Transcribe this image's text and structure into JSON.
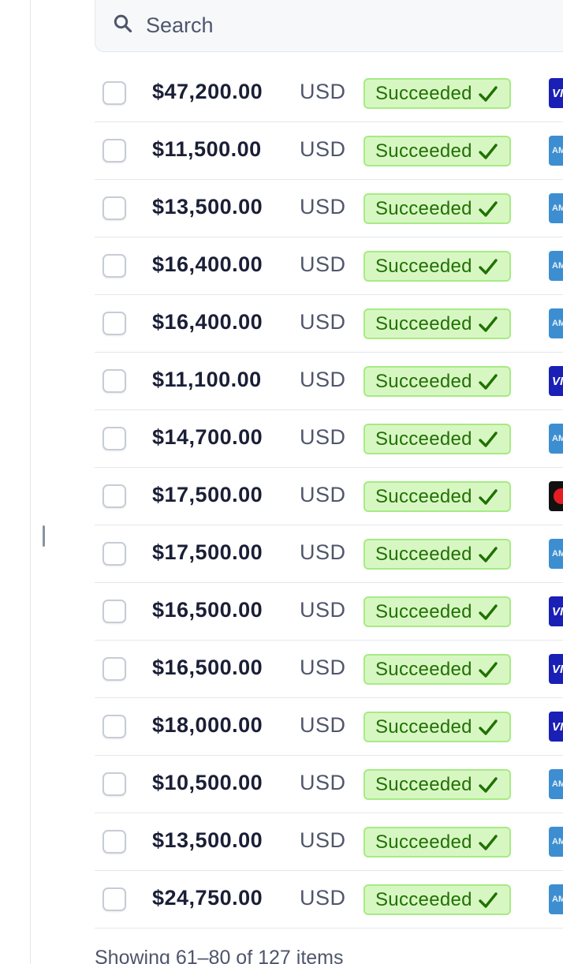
{
  "search": {
    "placeholder": "Search",
    "icon": "search-icon"
  },
  "payments": [
    {
      "amount": "$47,200.00",
      "currency": "USD",
      "status": "Succeeded",
      "card": "visa",
      "card_text": "VI"
    },
    {
      "amount": "$11,500.00",
      "currency": "USD",
      "status": "Succeeded",
      "card": "amex",
      "card_text": "AM"
    },
    {
      "amount": "$13,500.00",
      "currency": "USD",
      "status": "Succeeded",
      "card": "amex",
      "card_text": "AM"
    },
    {
      "amount": "$16,400.00",
      "currency": "USD",
      "status": "Succeeded",
      "card": "amex",
      "card_text": "AM"
    },
    {
      "amount": "$16,400.00",
      "currency": "USD",
      "status": "Succeeded",
      "card": "amex",
      "card_text": "AM"
    },
    {
      "amount": "$11,100.00",
      "currency": "USD",
      "status": "Succeeded",
      "card": "visa",
      "card_text": "VI"
    },
    {
      "amount": "$14,700.00",
      "currency": "USD",
      "status": "Succeeded",
      "card": "amex",
      "card_text": "AM"
    },
    {
      "amount": "$17,500.00",
      "currency": "USD",
      "status": "Succeeded",
      "card": "mastercard",
      "card_text": ""
    },
    {
      "amount": "$17,500.00",
      "currency": "USD",
      "status": "Succeeded",
      "card": "amex",
      "card_text": "AM"
    },
    {
      "amount": "$16,500.00",
      "currency": "USD",
      "status": "Succeeded",
      "card": "visa",
      "card_text": "VI"
    },
    {
      "amount": "$16,500.00",
      "currency": "USD",
      "status": "Succeeded",
      "card": "visa",
      "card_text": "VI"
    },
    {
      "amount": "$18,000.00",
      "currency": "USD",
      "status": "Succeeded",
      "card": "visa",
      "card_text": "VI"
    },
    {
      "amount": "$10,500.00",
      "currency": "USD",
      "status": "Succeeded",
      "card": "amex",
      "card_text": "AM"
    },
    {
      "amount": "$13,500.00",
      "currency": "USD",
      "status": "Succeeded",
      "card": "amex",
      "card_text": "AM"
    },
    {
      "amount": "$24,750.00",
      "currency": "USD",
      "status": "Succeeded",
      "card": "amex",
      "card_text": "AM"
    }
  ],
  "pagination": {
    "summary": "Showing 61–80 of 127 items"
  },
  "colors": {
    "success_bg": "#d7f7c2",
    "success_border": "#a6eb84",
    "success_text": "#217005",
    "visa": "#1a1fb5",
    "amex": "#3d8ed1",
    "mastercard_red": "#e51d22"
  }
}
